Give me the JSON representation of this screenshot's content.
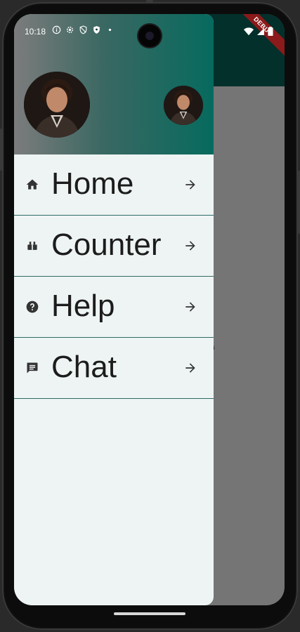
{
  "status_bar": {
    "time": "10:18",
    "icons": [
      "info-icon",
      "settings-icon",
      "shield-icon",
      "vpn-key-icon",
      "dot-icon"
    ],
    "right_icons": [
      "wifi-icon",
      "signal-icon",
      "battery-icon"
    ]
  },
  "debug_banner": {
    "label": "DEBUG"
  },
  "background_page": {
    "text": "ge"
  },
  "drawer": {
    "menu": [
      {
        "label": "Home",
        "icon": "home-icon"
      },
      {
        "label": "Counter",
        "icon": "counter-icon"
      },
      {
        "label": "Help",
        "icon": "help-icon"
      },
      {
        "label": "Chat",
        "icon": "chat-icon"
      }
    ]
  },
  "colors": {
    "drawer_bg": "#eef4f3",
    "header_gradient_start": "#7c7c7c",
    "header_gradient_end": "#066a5e",
    "divider": "#2c6a66",
    "app_bar": "#03302b",
    "scrim": "#757575"
  }
}
